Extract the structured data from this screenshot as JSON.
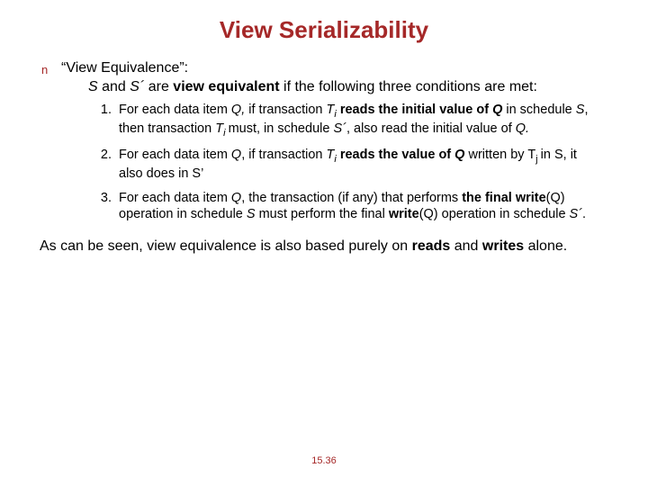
{
  "title": "View Serializability",
  "bullet_marker": "n",
  "bullet_head": "“View Equivalence”:",
  "intro_prefix_it": "S ",
  "intro_and": "and ",
  "intro_sprime_it": "S´ ",
  "intro_are": "are ",
  "intro_ve_bold": "view equivalent",
  "intro_tail": " if the following three conditions are met:",
  "c1_a": "For each data item ",
  "c1_Q": "Q,",
  "c1_b": " if transaction ",
  "c1_Ti": "T",
  "c1_Ti_sub": "i",
  "c1_c": " reads the initial value of ",
  "c1_Q2": "Q",
  "c1_d": " in schedule ",
  "c1_S": "S",
  "c1_e": ", then transaction ",
  "c1_Ti2": "T",
  "c1_Ti2_sub": "i ",
  "c1_f": " must, in schedule ",
  "c1_Sp": "S´",
  "c1_g": ", also read the initial value of ",
  "c1_Q3": "Q.",
  "c2_a": "For each data item ",
  "c2_Q": "Q",
  "c2_b": ", if transaction ",
  "c2_Ti": "T",
  "c2_Ti_sub": "i",
  "c2_c": " reads the value of ",
  "c2_Q2": "Q ",
  "c2_d": "written by ",
  "c2_Tj": "T",
  "c2_Tj_sub": "j ",
  "c2_e": " in S, it also does in S’",
  "c3_a": "For each data item ",
  "c3_Q": "Q",
  "c3_b": ", the transaction (if any) that performs ",
  "c3_fw": "the final write",
  "c3_paren": "(Q) ",
  "c3_c": "operation in schedule ",
  "c3_S": "S",
  "c3_d": " must perform the final ",
  "c3_wr": "write",
  "c3_paren2": "(Q) ",
  "c3_e": "operation in schedule ",
  "c3_Sp": "S´",
  "c3_f": ".",
  "conclusion_a": "As can be seen, view equivalence is also based purely on ",
  "conclusion_reads": "reads",
  "conclusion_b": " and ",
  "conclusion_writes": "writes",
  "conclusion_c": " alone.",
  "page_num": "15.36"
}
